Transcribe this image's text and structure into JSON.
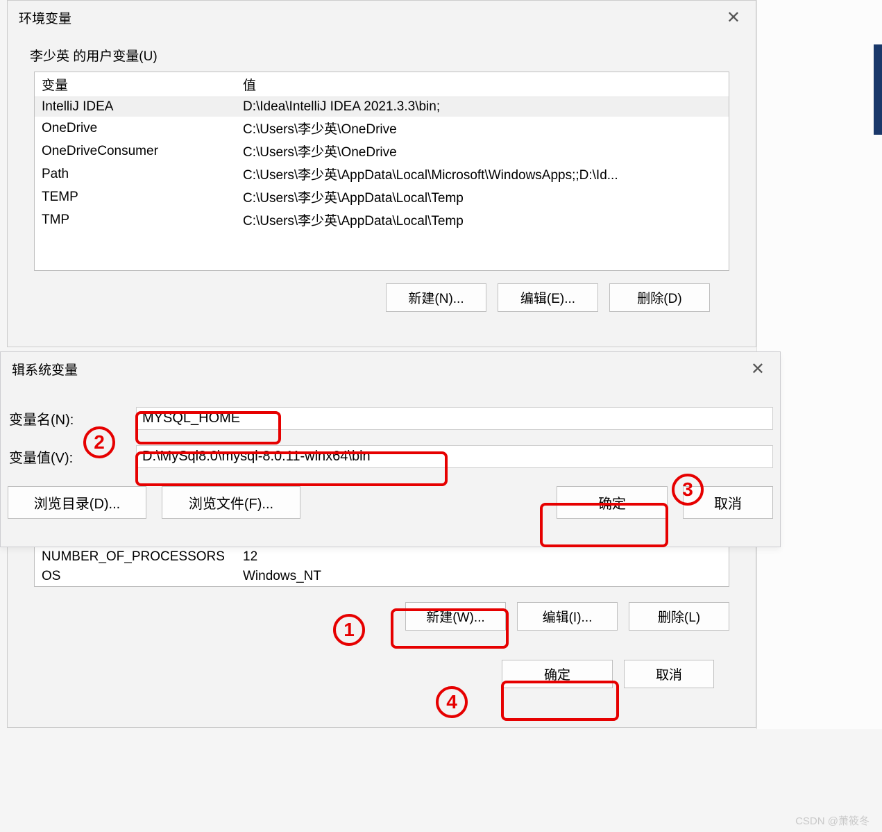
{
  "dialog1": {
    "title": "环境变量",
    "userGroup": "李少英 的用户变量(U)",
    "headers": {
      "var": "变量",
      "val": "值"
    },
    "rows": [
      {
        "var": "IntelliJ IDEA",
        "val": "D:\\Idea\\IntelliJ IDEA 2021.3.3\\bin;"
      },
      {
        "var": "OneDrive",
        "val": "C:\\Users\\李少英\\OneDrive"
      },
      {
        "var": "OneDriveConsumer",
        "val": "C:\\Users\\李少英\\OneDrive"
      },
      {
        "var": "Path",
        "val": "C:\\Users\\李少英\\AppData\\Local\\Microsoft\\WindowsApps;;D:\\Id..."
      },
      {
        "var": "TEMP",
        "val": "C:\\Users\\李少英\\AppData\\Local\\Temp"
      },
      {
        "var": "TMP",
        "val": "C:\\Users\\李少英\\AppData\\Local\\Temp"
      }
    ],
    "buttons": {
      "new": "新建(N)...",
      "edit": "编辑(E)...",
      "del": "删除(D)"
    }
  },
  "dialog2": {
    "title": "辑系统变量",
    "nameLabel": "变量名(N):",
    "valueLabel": "变量值(V):",
    "nameValue": "MYSQL_HOME",
    "valueValue": "D:\\MySql8.0\\mysql-8.0.11-winx64\\bin",
    "browseDir": "浏览目录(D)...",
    "browseFile": "浏览文件(F)...",
    "ok": "确定",
    "cancel": "取消"
  },
  "sys": {
    "rows": [
      {
        "var": "NUMBER_OF_PROCESSORS",
        "val": "12"
      },
      {
        "var": "OS",
        "val": "Windows_NT"
      }
    ],
    "buttons": {
      "new": "新建(W)...",
      "edit": "编辑(I)...",
      "del": "删除(L)"
    },
    "ok": "确定",
    "cancel": "取消"
  },
  "annotations": {
    "c1": "1",
    "c2": "2",
    "c3": "3",
    "c4": "4"
  },
  "watermark": "CSDN @萧筱冬"
}
